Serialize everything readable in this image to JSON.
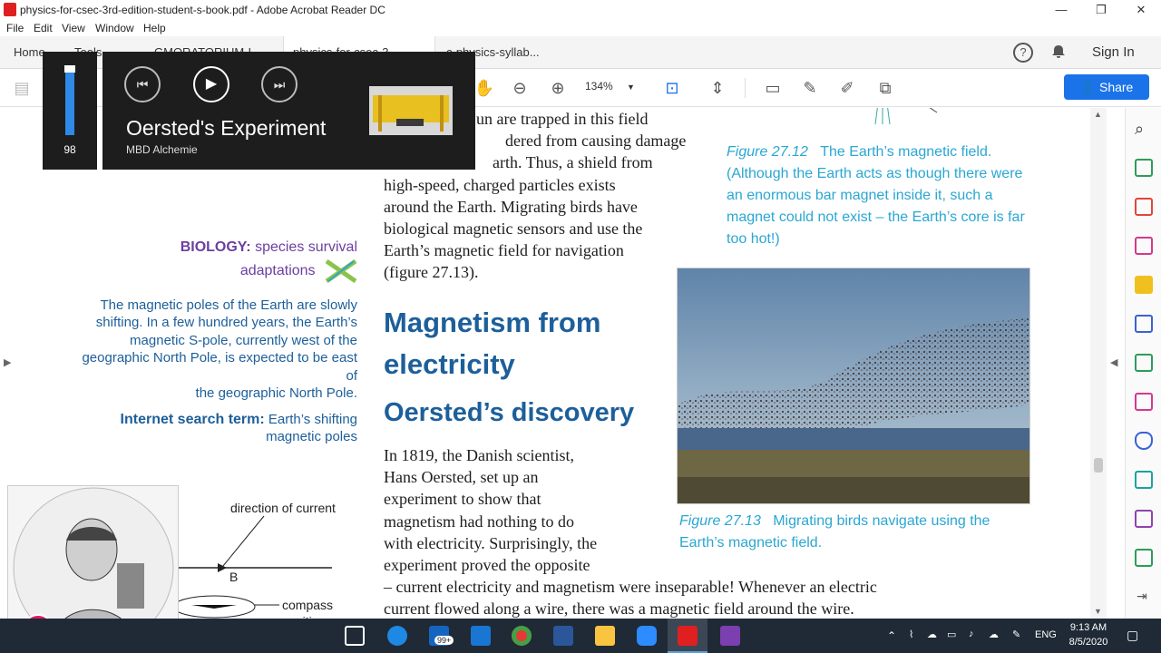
{
  "window": {
    "title": "physics-for-csec-3rd-edition-student-s-book.pdf - Adobe Acrobat Reader DC",
    "controls": [
      "—",
      "❐",
      "✕"
    ]
  },
  "menu": [
    "File",
    "Edit",
    "View",
    "Window",
    "Help"
  ],
  "tabs": [
    {
      "label": "Home"
    },
    {
      "label": "Tools"
    },
    {
      "label": "GMORATORIUM-I..."
    },
    {
      "label": "physics-for-csec-3..."
    },
    {
      "label": "c-physics-syllab..."
    }
  ],
  "header_right": {
    "sign_in": "Sign In"
  },
  "toolbar": {
    "zoom": "134%",
    "share_label": "Share"
  },
  "media": {
    "volume_level": "98",
    "volume_fraction": 0.98,
    "track_title": "Oersted's Experiment",
    "artist": "MBD Alchemie"
  },
  "document": {
    "para_top": [
      "un are trapped in this field",
      "dered from causing damage",
      "arth. Thus, a shield from",
      "high-speed, charged particles exists",
      "around the Earth. Migrating birds have",
      "biological magnetic sensors and use the",
      "Earth’s magnetic field for navigation",
      "(figure 27.13)."
    ],
    "fig1_caption_label": "Figure 27.12",
    "fig1_caption_lines": [
      "The Earth’s magnetic field.",
      "(Although the Earth acts as though there were",
      "an enormous bar magnet inside it, such a",
      "magnet could not exist – the Earth’s core is far",
      "too hot!)"
    ],
    "sidebar_head_1": "BIOLOGY:",
    "sidebar_head_2": "species survival",
    "sidebar_head_3": "adaptations",
    "sidebar_lines": [
      "The magnetic poles of the Earth are slowly",
      "shifting. In a few hundred years, the Earth’s",
      "magnetic S-pole, currently west of the",
      "geographic North Pole, is expected to be east of",
      "the geographic North Pole."
    ],
    "search_term_label": "Internet search term:",
    "search_term_value_1": "Earth’s shifting",
    "search_term_value_2": "magnetic poles",
    "heading_1a": "Magnetism from",
    "heading_1b": "electricity",
    "heading_2": "Oersted’s discovery",
    "para_oersted": [
      "In 1819, the Danish scientist,",
      "Hans Oersted, set up an",
      "experiment to show that",
      "magnetism had nothing to do",
      "with electricity. Surprisingly, the",
      "experiment proved the opposite",
      "– current electricity and magnetism were inseparable! Whenever an electric",
      "current flowed along a wire, there was a magnetic field around the wire."
    ],
    "fig2_caption_label": "Figure 27.13",
    "fig2_caption_lines": [
      "Migrating birds navigate using the",
      "Earth’s magnetic field."
    ],
    "diagram_labels": {
      "current": "direction of current",
      "point_b": "B",
      "compass": "compass",
      "position": "position"
    }
  },
  "taskbar": {
    "badge": "99+",
    "lang": "ENG",
    "time": "9:13 AM",
    "date": "8/5/2020"
  }
}
